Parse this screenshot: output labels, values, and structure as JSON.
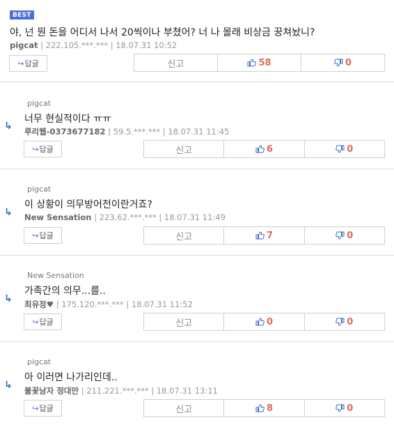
{
  "best_label": "BEST",
  "reply_label": "답글",
  "report_label": "신고",
  "comments": [
    {
      "reply_to": "",
      "text": "야, 넌 뭔 돈을 어디서 나서 20씩이나 부쳤어? 너 나 몰래 비상금 꿍쳐놨니?",
      "author": "pigcat",
      "ip": "222.105.***.***",
      "date": "18.07.31 10:52",
      "likes": "58",
      "dislikes": "0"
    },
    {
      "reply_to": "pigcat",
      "text": "너무 현실적이다 ㅠㅠ",
      "author": "루리웹-0373677182",
      "ip": "59.5.***.***",
      "date": "18.07.31 11:45",
      "likes": "6",
      "dislikes": "0"
    },
    {
      "reply_to": "pigcat",
      "text": "이 상황이 의무방어전이란거죠?",
      "author": "New Sensation",
      "ip": "223.62.***.***",
      "date": "18.07.31 11:49",
      "likes": "7",
      "dislikes": "0"
    },
    {
      "reply_to": "New Sensation",
      "text": "가족간의 의무...를..",
      "author": "최유정♥",
      "ip": "175.120.***.***",
      "date": "18.07.31 11:52",
      "likes": "0",
      "dislikes": "0"
    },
    {
      "reply_to": "pigcat",
      "text": "아 이러면 나가리인데..",
      "author": "불꽃남자 정대만",
      "ip": "211.221.***.***",
      "date": "18.07.31 13:11",
      "likes": "8",
      "dislikes": "0"
    }
  ],
  "colors": {
    "accent": "#4a6fd8",
    "count": "#e26a5c",
    "separator": "#dcdcdc"
  },
  "icons": {
    "reply": "reply-arrow-icon",
    "like": "thumbs-up-icon",
    "dislike": "thumbs-down-icon"
  }
}
